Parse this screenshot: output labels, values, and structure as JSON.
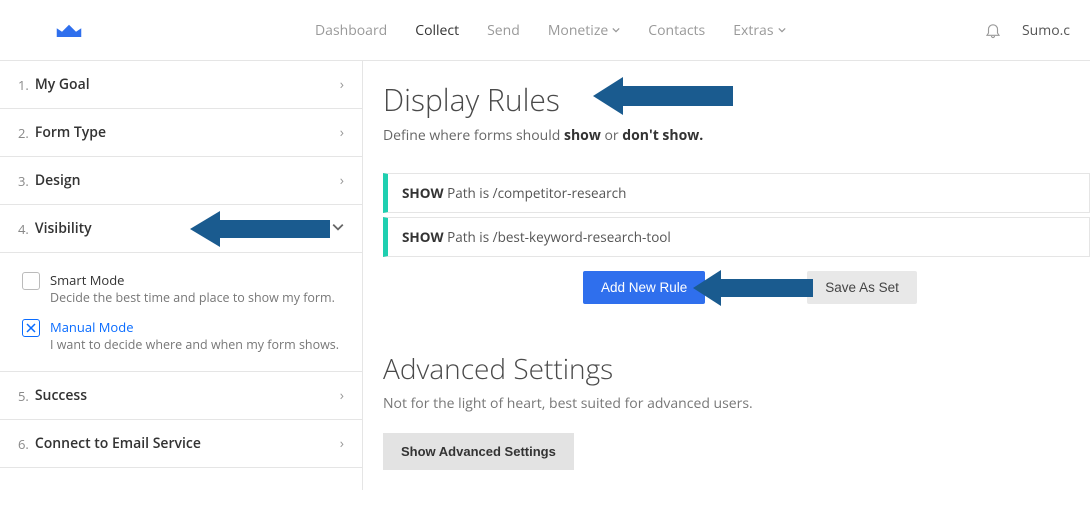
{
  "header": {
    "nav": [
      "Dashboard",
      "Collect",
      "Send",
      "Monetize",
      "Contacts",
      "Extras"
    ],
    "active_nav": "Collect",
    "account": "Sumo.c"
  },
  "sidebar": {
    "steps": [
      {
        "num": "1.",
        "label": "My Goal"
      },
      {
        "num": "2.",
        "label": "Form Type"
      },
      {
        "num": "3.",
        "label": "Design"
      },
      {
        "num": "4.",
        "label": "Visibility"
      },
      {
        "num": "5.",
        "label": "Success"
      },
      {
        "num": "6.",
        "label": "Connect to Email Service"
      }
    ],
    "modes": {
      "smart": {
        "title": "Smart Mode",
        "desc": "Decide the best time and place to show my form."
      },
      "manual": {
        "title": "Manual Mode",
        "desc": "I want to decide where and when my form shows."
      }
    }
  },
  "main": {
    "title": "Display Rules",
    "subtitle_pre": "Define where forms should ",
    "subtitle_show": "show",
    "subtitle_or": " or ",
    "subtitle_dont": "don't show.",
    "rules": [
      {
        "action": "SHOW",
        "cond": " Path is /competitor-research"
      },
      {
        "action": "SHOW",
        "cond": " Path is /best-keyword-research-tool"
      }
    ],
    "add_rule": "Add New Rule",
    "save_set": "Save As Set",
    "adv_title": "Advanced Settings",
    "adv_sub": "Not for the light of heart, best suited for advanced users.",
    "adv_btn": "Show Advanced Settings"
  }
}
